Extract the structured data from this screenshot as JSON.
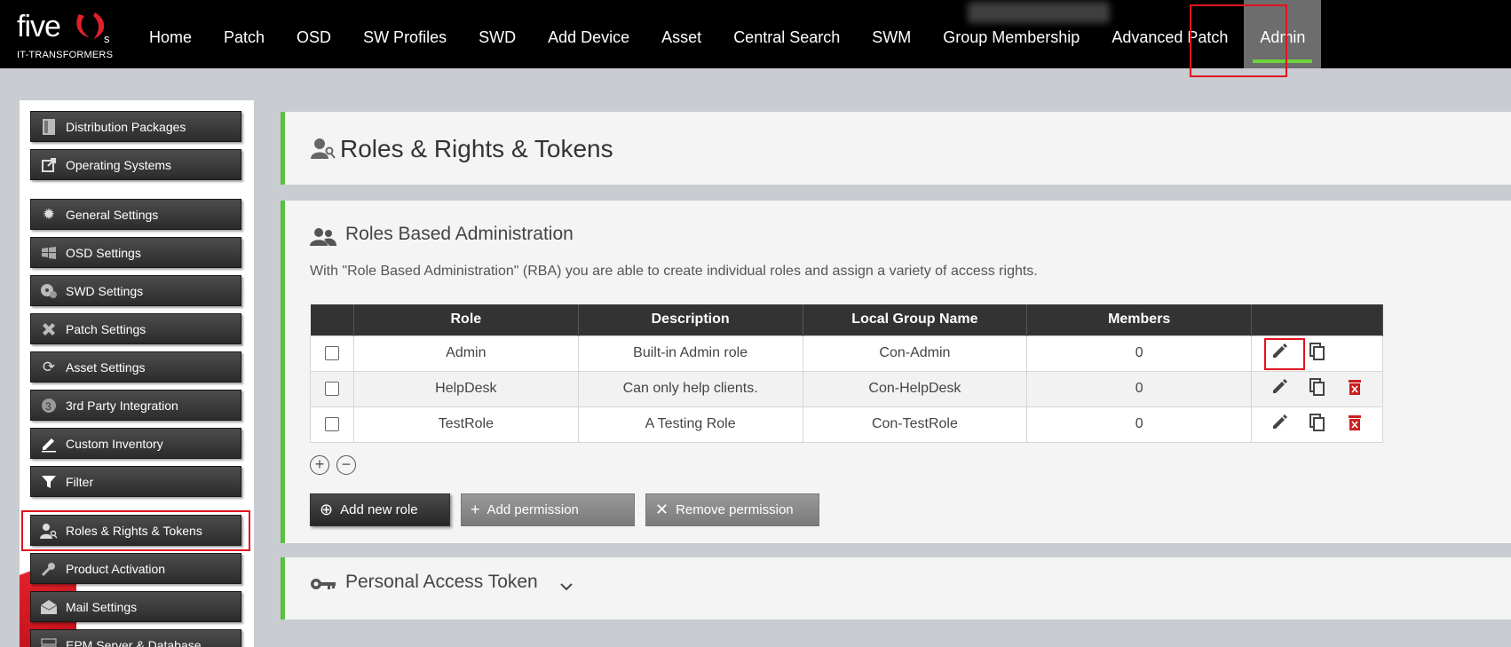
{
  "brand": {
    "name": "five",
    "suffix": "s",
    "tagline": "IT-TRANSFORMERS"
  },
  "nav": {
    "items": [
      {
        "label": "Home"
      },
      {
        "label": "Patch"
      },
      {
        "label": "OSD"
      },
      {
        "label": "SW Profiles"
      },
      {
        "label": "SWD"
      },
      {
        "label": "Add Device"
      },
      {
        "label": "Asset"
      },
      {
        "label": "Central Search"
      },
      {
        "label": "SWM"
      },
      {
        "label": "Group Membership"
      },
      {
        "label": "Advanced Patch"
      },
      {
        "label": "Admin",
        "active": true
      }
    ]
  },
  "sidebar": {
    "items": [
      {
        "label": "Distribution Packages",
        "icon": "package-icon"
      },
      {
        "label": "Operating Systems",
        "icon": "external-link-icon"
      },
      {
        "label": "General Settings",
        "icon": "gear-icon"
      },
      {
        "label": "OSD Settings",
        "icon": "windows-icon"
      },
      {
        "label": "SWD Settings",
        "icon": "disc-icon"
      },
      {
        "label": "Patch Settings",
        "icon": "patch-icon"
      },
      {
        "label": "Asset Settings",
        "icon": "refresh-icon"
      },
      {
        "label": "3rd Party Integration",
        "icon": "integration-icon"
      },
      {
        "label": "Custom Inventory",
        "icon": "pencil-icon"
      },
      {
        "label": "Filter",
        "icon": "filter-icon"
      },
      {
        "label": "Roles & Rights & Tokens",
        "icon": "user-key-icon",
        "active": true
      },
      {
        "label": "Product Activation",
        "icon": "wrench-icon"
      },
      {
        "label": "Mail Settings",
        "icon": "mail-icon"
      },
      {
        "label": "EPM Server & Database",
        "icon": "server-icon"
      }
    ]
  },
  "page": {
    "title": "Roles & Rights & Tokens"
  },
  "rba": {
    "title": "Roles Based Administration",
    "description": "With \"Role Based Administration\" (RBA) you are able to create individual roles and assign a variety of access rights.",
    "columns": [
      "Role",
      "Description",
      "Local Group Name",
      "Members"
    ],
    "rows": [
      {
        "role": "Admin",
        "description": "Built-in Admin role",
        "group": "Con-Admin",
        "members": "0",
        "deletable": false
      },
      {
        "role": "HelpDesk",
        "description": "Can only help clients.",
        "group": "Con-HelpDesk",
        "members": "0",
        "deletable": true
      },
      {
        "role": "TestRole",
        "description": "A Testing Role",
        "group": "Con-TestRole",
        "members": "0",
        "deletable": true
      }
    ],
    "buttons": {
      "add_role": "Add new role",
      "add_permission": "Add permission",
      "remove_permission": "Remove permission"
    }
  },
  "pat": {
    "title": "Personal Access Token"
  },
  "colors": {
    "accent_green": "#5bbf40",
    "highlight_red": "#e0141e",
    "delete_red": "#cc1f1f"
  }
}
